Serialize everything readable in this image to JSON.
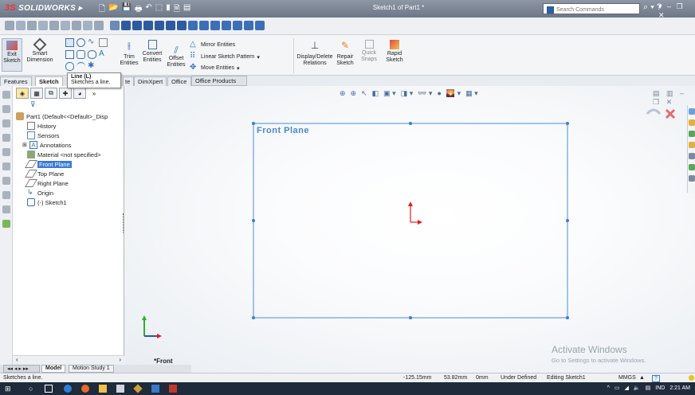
{
  "app": {
    "logo_prefix": "3S",
    "logo_text": "SOLIDWORKS",
    "document_title": "Sketch1 of Part1 *"
  },
  "search": {
    "placeholder": "Search Commands"
  },
  "command_manager": {
    "exit_sketch": "Exit Sketch",
    "smart_dimension": "Smart Dimension",
    "trim_entities": "Trim Entities",
    "convert_entities": "Convert Entities",
    "offset_entities": "Offset Entities",
    "mirror_entities": "Mirror Entities",
    "linear_sketch_pattern": "Linear Sketch Pattern",
    "move_entities": "Move Entities",
    "display_delete_relations": "Display/Delete Relations",
    "repair_sketch": "Repair Sketch",
    "quick_snaps": "Quick Snaps",
    "rapid_sketch": "Rapid Sketch"
  },
  "tabs": {
    "features": "Features",
    "sketch": "Sketch",
    "partial_evaluate": "te",
    "dimxpert": "DimXpert",
    "office_products": "Office Products"
  },
  "tooltip": {
    "title": "Line (L)",
    "body": "Sketches a line."
  },
  "tree": {
    "root": "Part1 (Default<<Default>_Disp",
    "history": "History",
    "sensors": "Sensors",
    "annotations": "Annotations",
    "material": "Material <not specified>",
    "front_plane": "Front Plane",
    "top_plane": "Top Plane",
    "right_plane": "Right Plane",
    "origin": "Origin",
    "sketch1": "(-) Sketch1"
  },
  "graphics": {
    "plane_label": "Front Plane",
    "view_label": "*Front"
  },
  "watermark": {
    "line1": "Activate Windows",
    "line2": "Go to Settings to activate Windows."
  },
  "bottom_tabs": {
    "model": "Model",
    "motion_study": "Motion Study 1"
  },
  "status": {
    "message": "Sketches a line.",
    "x": "-125.15mm",
    "y": "53.82mm",
    "z": "0mm",
    "state": "Under Defined",
    "mode": "Editing Sketch1",
    "units": "MMGS",
    "units_caret": "▲"
  },
  "taskbar": {
    "lang": "IND",
    "time": "2:21 AM"
  },
  "colors": {
    "accent": "#3b7bd6",
    "plane": "#4d87cc",
    "origin": "#e02020",
    "titlebar": "#7a8494"
  }
}
